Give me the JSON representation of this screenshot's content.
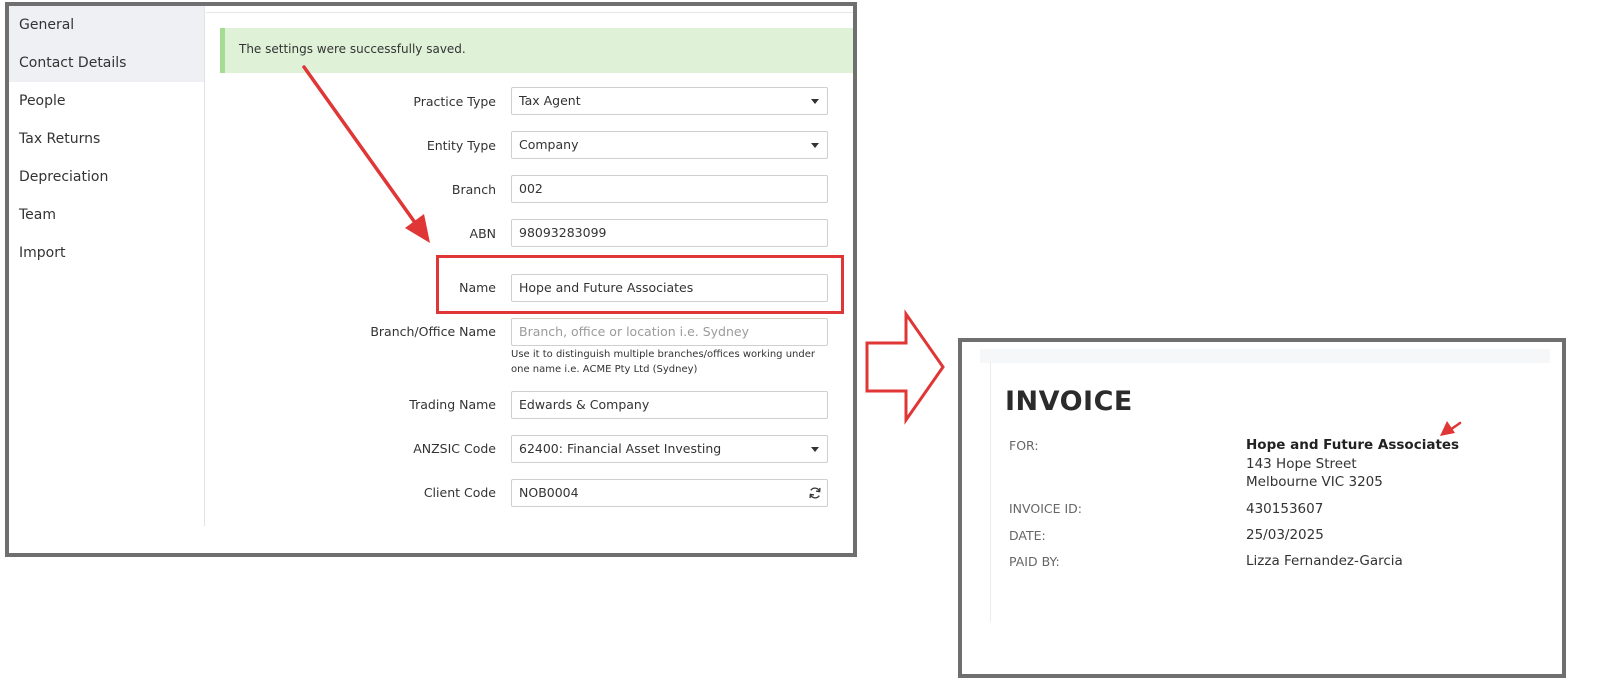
{
  "sidebar": {
    "items": [
      {
        "label": "General",
        "active": true
      },
      {
        "label": "Contact Details",
        "active": true
      },
      {
        "label": "People",
        "active": false
      },
      {
        "label": "Tax Returns",
        "active": false
      },
      {
        "label": "Depreciation",
        "active": false
      },
      {
        "label": "Team",
        "active": false
      },
      {
        "label": "Import",
        "active": false
      }
    ]
  },
  "alert": {
    "message": "The settings were successfully saved."
  },
  "form": {
    "practice_type": {
      "label": "Practice Type",
      "value": "Tax Agent"
    },
    "entity_type": {
      "label": "Entity Type",
      "value": "Company"
    },
    "branch": {
      "label": "Branch",
      "value": "002"
    },
    "abn": {
      "label": "ABN",
      "value": "98093283099"
    },
    "name": {
      "label": "Name",
      "value": "Hope and Future Associates"
    },
    "branch_office_name": {
      "label": "Branch/Office Name",
      "placeholder": "Branch, office or location i.e. Sydney",
      "help": "Use it to distinguish multiple branches/offices working under one name i.e. ACME Pty Ltd (Sydney)"
    },
    "trading_name": {
      "label": "Trading Name",
      "value": "Edwards & Company"
    },
    "anzsic_code": {
      "label": "ANZSIC Code",
      "value": "62400: Financial Asset Investing"
    },
    "client_code": {
      "label": "Client Code",
      "value": "NOB0004"
    }
  },
  "invoice": {
    "title": "INVOICE",
    "for_label": "FOR:",
    "for_name": "Hope and Future Associates",
    "for_address_1": "143 Hope Street",
    "for_address_2": "Melbourne VIC 3205",
    "id_label": "INVOICE ID:",
    "id_value": "430153607",
    "date_label": "DATE:",
    "date_value": "25/03/2025",
    "paid_by_label": "PAID BY:",
    "paid_by_value": "Lizza Fernandez-Garcia"
  },
  "colors": {
    "annotation_red": "#e03636",
    "success_bg": "#dff2d8",
    "success_border": "#a5dc94",
    "frame_gray": "#6f6f6f"
  },
  "icons": {
    "select_caret": "chevron-down-icon",
    "client_code_action": "refresh-icon"
  }
}
